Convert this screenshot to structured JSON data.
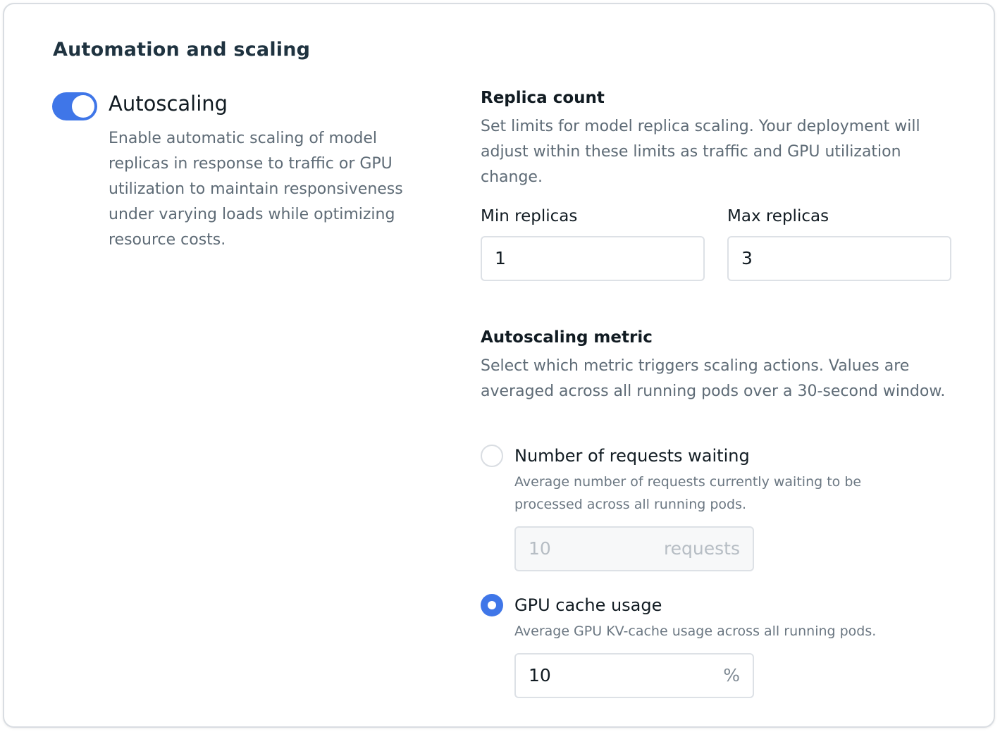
{
  "section": {
    "title": "Automation and scaling"
  },
  "autoscaling": {
    "enabled": true,
    "title": "Autoscaling",
    "description": "Enable automatic scaling of model replicas in response to traffic or GPU utilization to maintain responsiveness under varying loads while optimizing resource costs."
  },
  "replica_count": {
    "title": "Replica count",
    "description": "Set limits for model replica scaling. Your deployment will adjust within these limits as traffic and GPU utilization change.",
    "min_label": "Min replicas",
    "min_value": "1",
    "max_label": "Max replicas",
    "max_value": "3"
  },
  "metric": {
    "title": "Autoscaling metric",
    "description": "Select which metric triggers scaling actions. Values are averaged across all running pods over a 30-second window.",
    "options": [
      {
        "label": "Number of requests waiting",
        "description": "Average number of requests currently waiting to be processed across all running pods.",
        "value": "10",
        "unit": "requests",
        "selected": false
      },
      {
        "label": "GPU cache usage",
        "description": "Average GPU KV-cache usage across all running pods.",
        "value": "10",
        "unit": "%",
        "selected": true
      }
    ]
  },
  "colors": {
    "accent": "#3f76e8",
    "title": "#1f3340",
    "muted_text": "#5e6b76",
    "border": "#dde1e6"
  }
}
